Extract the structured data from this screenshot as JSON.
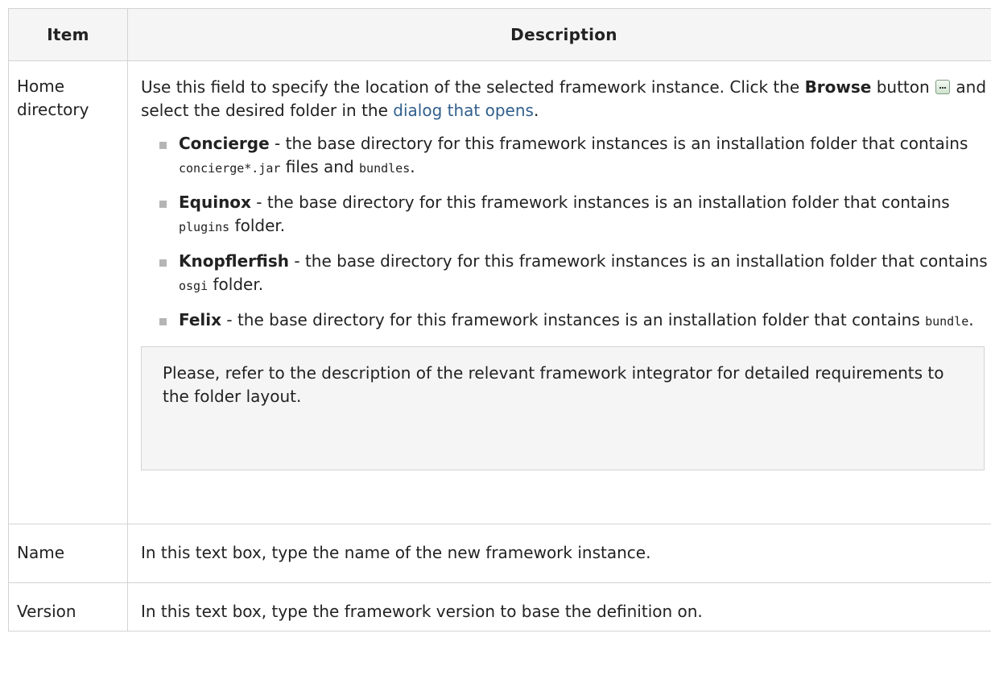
{
  "table": {
    "headers": {
      "item": "Item",
      "description": "Description"
    },
    "home": {
      "item_line1": "Home",
      "item_line2": "directory",
      "intro_part1": "Use this field to specify the location of the selected framework instance. Click the ",
      "browse_label": "Browse",
      "intro_part2": " button ",
      "intro_part3": " and select the desired folder in the ",
      "link_text": "dialog that opens",
      "intro_end": ".",
      "frameworks": [
        {
          "name": "Concierge",
          "text1": " - the base directory for this framework instances is an installation folder that contains ",
          "code1": "concierge*.jar",
          "text2": " files and ",
          "code2": "bundles",
          "text3": "."
        },
        {
          "name": "Equinox",
          "text1": " - the base directory for this framework instances is an installation folder that contains ",
          "code1": "plugins",
          "text2": " folder."
        },
        {
          "name": "Knopflerfish",
          "text1": " - the base directory for this framework instances is an installation folder that contains ",
          "code1": "osgi",
          "text2": " folder."
        },
        {
          "name": "Felix",
          "text1": " - the base directory for this framework instances is an installation folder that contains ",
          "code1": "bundle",
          "text2": "."
        }
      ],
      "note": "Please, refer to the description of the relevant framework integrator for detailed requirements to the folder layout."
    },
    "name_row": {
      "item": "Name",
      "description": "In this text box, type the name of the new framework instance."
    },
    "version_row": {
      "item": "Version",
      "description": "In this text box, type the framework version to base the definition on."
    }
  },
  "icons": {
    "browse_button": "ellipsis-button-icon",
    "bullet": "square-bullet-icon"
  },
  "colors": {
    "link": "#315f8d",
    "header_bg": "#f5f5f5",
    "border": "#d3d3d3",
    "bullet": "#b5b5b5"
  }
}
